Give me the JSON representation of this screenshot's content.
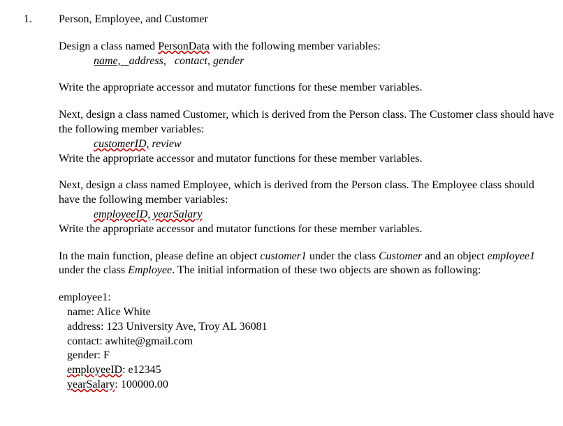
{
  "list_number": "1.",
  "title": "Person, Employee, and Customer",
  "p1_a": "Design a class named ",
  "p1_cls": "PersonData",
  "p1_b": " with the following member variables:",
  "p1_vars_name": "name,",
  "p1_vars_sp": "   ",
  "p1_vars_rest": "address,   contact, gender",
  "p2": "Write the appropriate accessor and mutator functions for these member variables.",
  "p3": "Next, design a class named Customer, which is derived from the Person class. The Customer class should have the following member variables:",
  "p3_vars_a": "customerID,",
  "p3_vars_b": " review",
  "p4": "Write the appropriate accessor and mutator functions for these member variables.",
  "p5": "Next, design a class named Employee, which is derived from the Person class. The Employee class should have the following member variables:",
  "p5_vars_a": "employeeID,",
  "p5_vars_b": " ",
  "p5_vars_c": "yearSalary",
  "p6": "Write the appropriate accessor and mutator functions for these member variables.",
  "p7_a": "In the main function, please define an object ",
  "p7_cust": "customer1",
  "p7_b": " under the class ",
  "p7_custcls": "Customer",
  "p7_c": " and an object ",
  "p7_emp": "employee1",
  "p7_d": " under the class ",
  "p7_empcls": "Employee",
  "p7_e": ". The initial information of these two objects are shown as following:",
  "emp_header": "employee1:",
  "emp_name": "name: Alice White",
  "emp_addr": "address: 123 University Ave, Troy AL 36081",
  "emp_contact": "contact: awhite@gmail.com",
  "emp_gender": "gender: F",
  "emp_id_lbl": "employeeID",
  "emp_id_val": ": e12345",
  "emp_sal_lbl": "yearSalary",
  "emp_sal_val": ": 100000.00"
}
